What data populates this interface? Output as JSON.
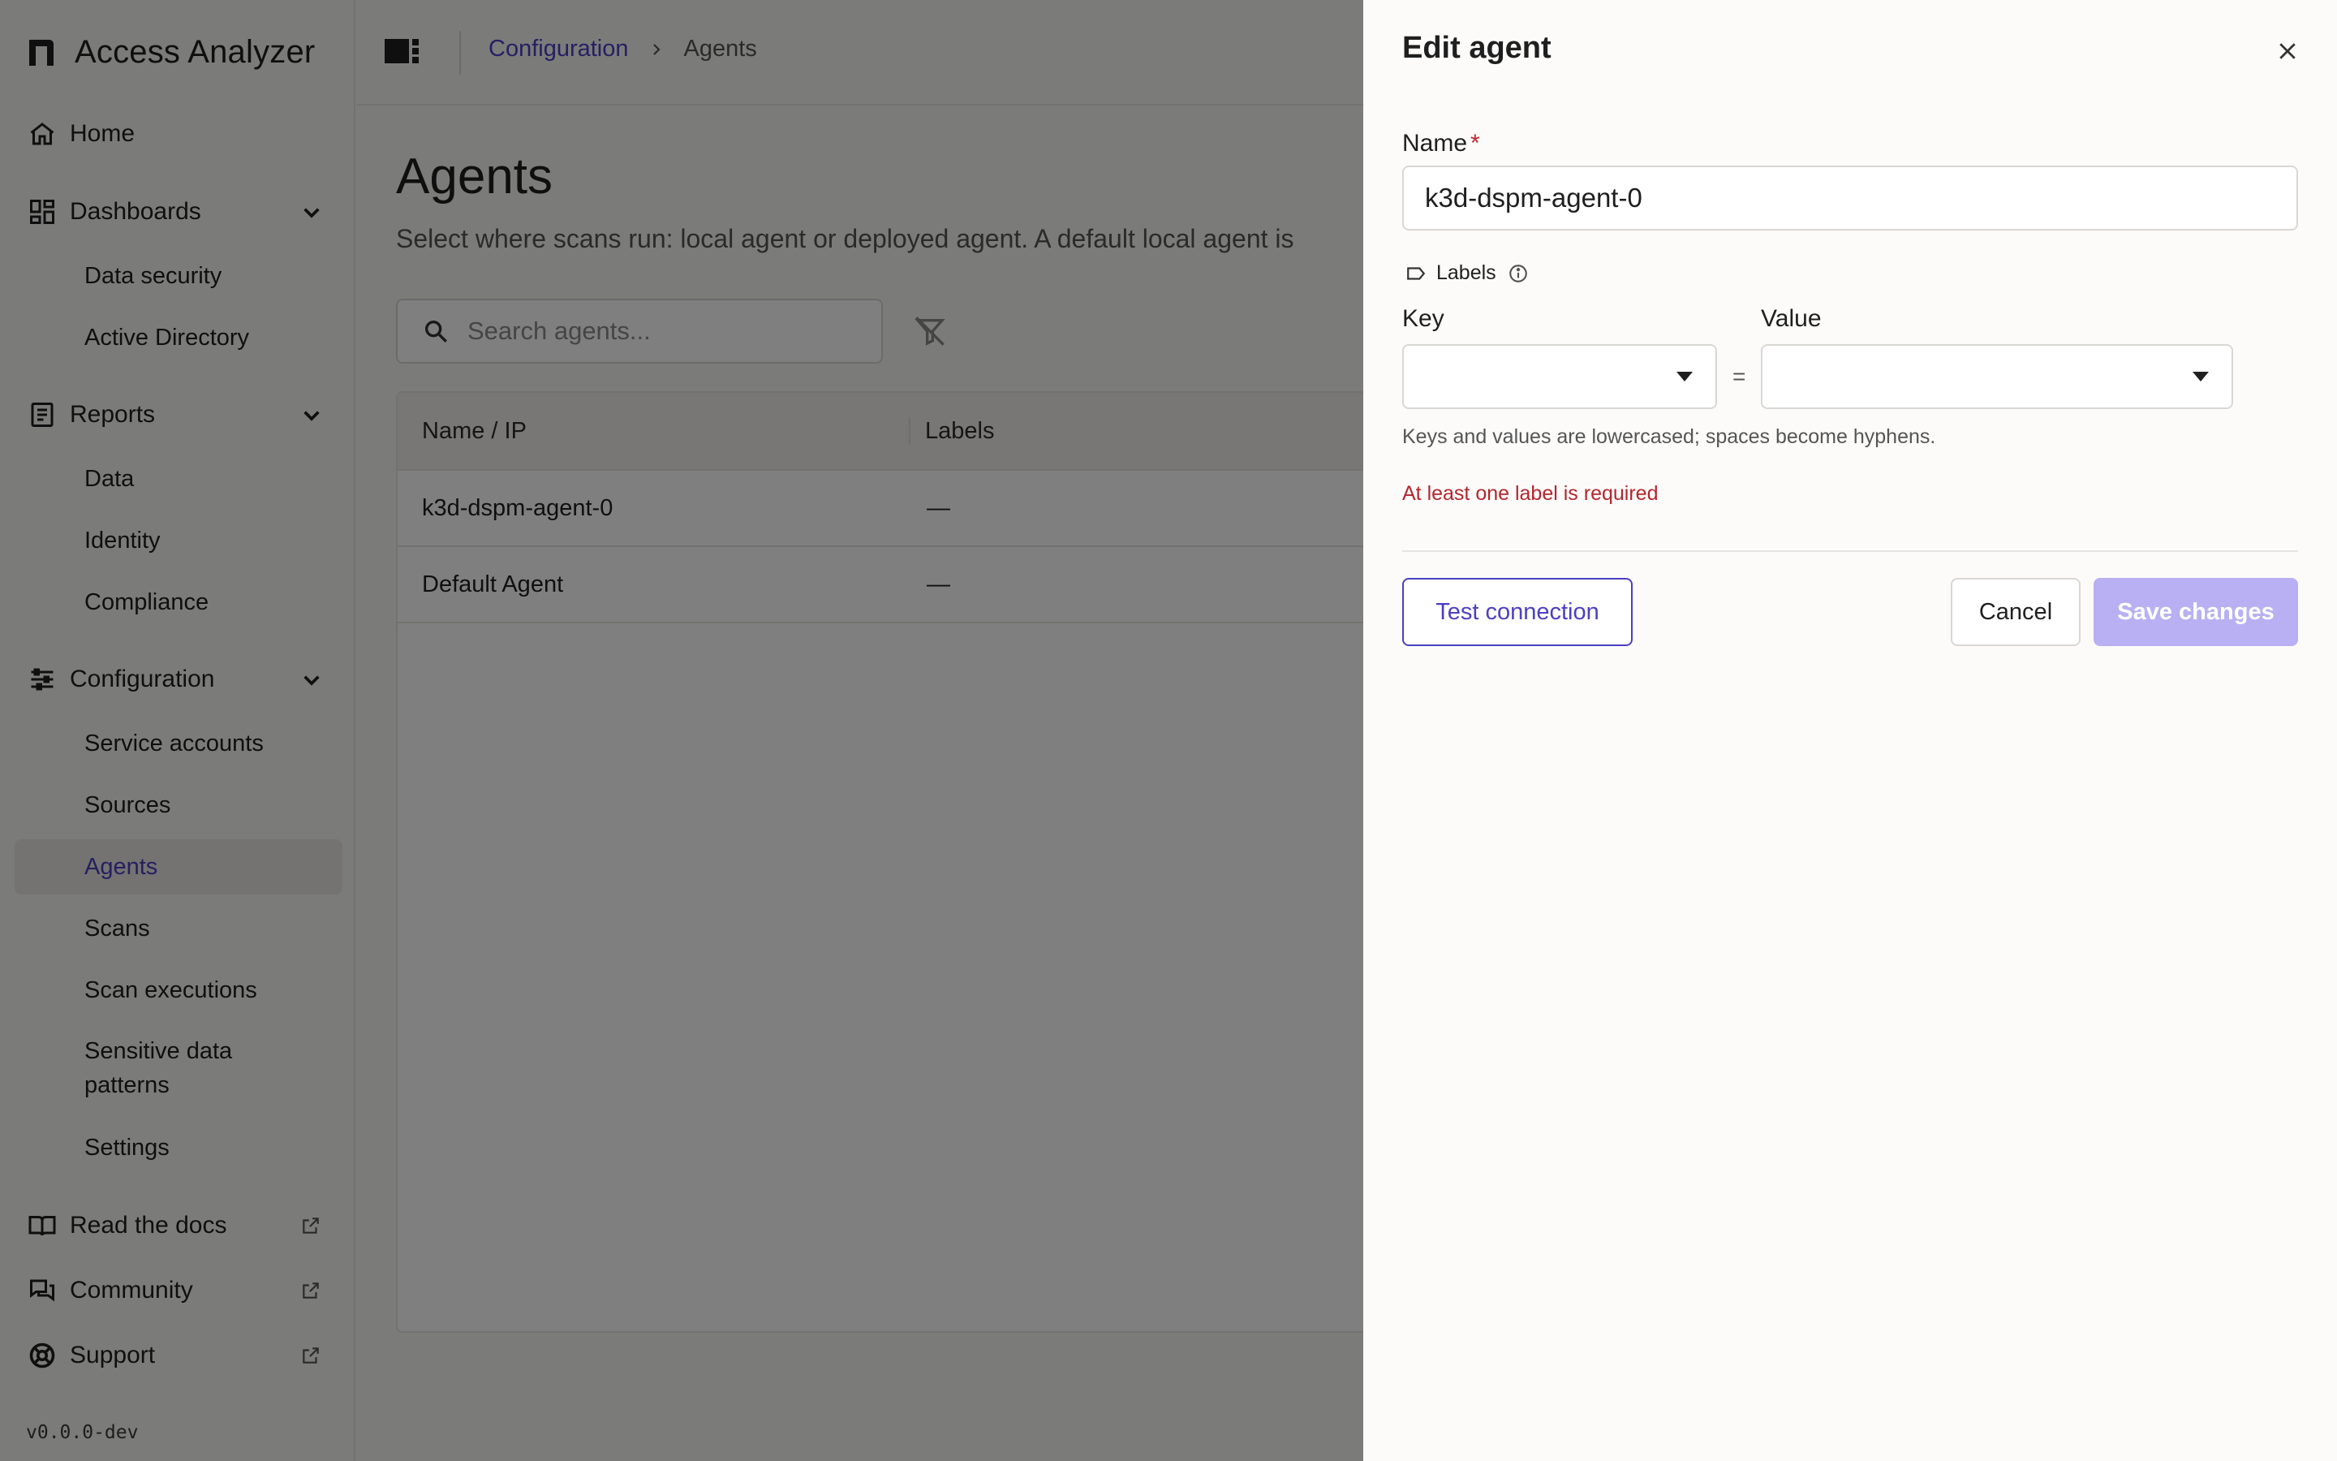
{
  "app": {
    "name": "Access Analyzer",
    "version": "v0.0.0-dev"
  },
  "sidebar": {
    "home": "Home",
    "dashboards": {
      "label": "Dashboards",
      "items": [
        "Data security",
        "Active Directory"
      ]
    },
    "reports": {
      "label": "Reports",
      "items": [
        "Data",
        "Identity",
        "Compliance"
      ]
    },
    "configuration": {
      "label": "Configuration",
      "items": [
        "Service accounts",
        "Sources",
        "Agents",
        "Scans",
        "Scan executions",
        "Sensitive data patterns",
        "Settings"
      ],
      "active": "Agents"
    },
    "links": [
      "Read the docs",
      "Community",
      "Support"
    ]
  },
  "breadcrumb": {
    "parent": "Configuration",
    "current": "Agents"
  },
  "page": {
    "title": "Agents",
    "description": "Select where scans run: local agent or deployed agent. A default local agent is"
  },
  "search": {
    "placeholder": "Search agents..."
  },
  "table": {
    "columns": [
      "Name / IP",
      "Labels"
    ],
    "rows": [
      {
        "name": "k3d-dspm-agent-0",
        "labels": "—"
      },
      {
        "name": "Default Agent",
        "labels": "—"
      }
    ]
  },
  "drawer": {
    "title": "Edit agent",
    "name_label": "Name",
    "required_mark": "*",
    "name_value": "k3d-dspm-agent-0",
    "labels_heading": "Labels",
    "key_label": "Key",
    "value_label": "Value",
    "equals": "=",
    "hint": "Keys and values are lowercased; spaces become hyphens.",
    "error": "At least one label is required",
    "buttons": {
      "test": "Test connection",
      "cancel": "Cancel",
      "save": "Save changes"
    }
  },
  "colors": {
    "accent": "#4b3fc4",
    "save_disabled": "#b9b0f3",
    "error": "#b3262d"
  }
}
